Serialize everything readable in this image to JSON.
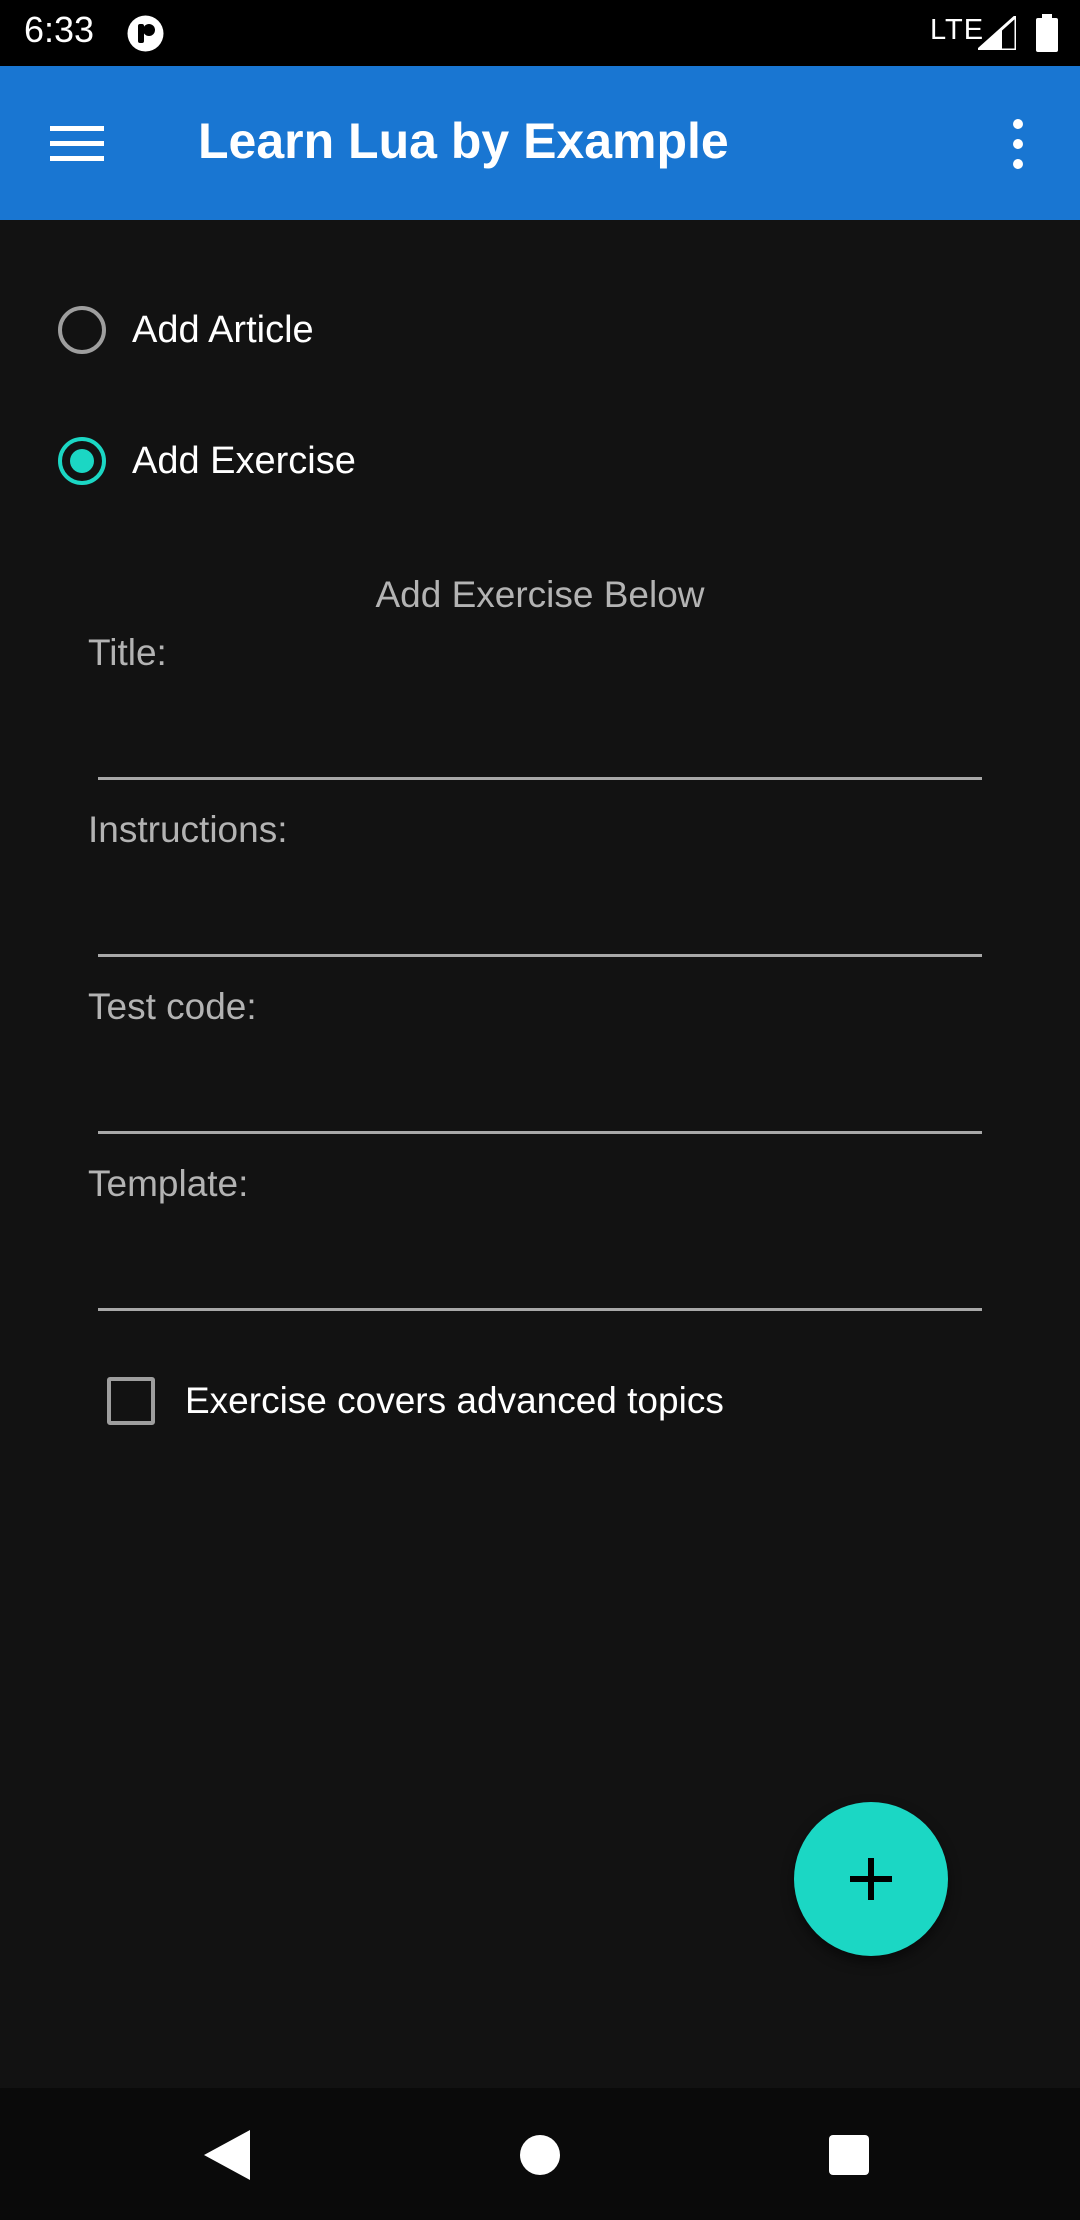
{
  "status_bar": {
    "time": "6:33",
    "network": "LTE",
    "icons": [
      "app-notification-icon",
      "signal-icon",
      "battery-icon"
    ]
  },
  "app_bar": {
    "title": "Learn Lua by Example",
    "icons": [
      "menu-icon",
      "more-vert-icon"
    ],
    "color": "#1976d2"
  },
  "mode": {
    "options": [
      {
        "label": "Add Article",
        "selected": false
      },
      {
        "label": "Add Exercise",
        "selected": true
      }
    ],
    "accent_color": "#1bd7c4"
  },
  "form": {
    "heading": "Add Exercise Below",
    "fields": [
      {
        "label": "Title:",
        "value": ""
      },
      {
        "label": "Instructions:",
        "value": ""
      },
      {
        "label": "Test code:",
        "value": ""
      },
      {
        "label": "Template:",
        "value": ""
      }
    ],
    "advanced_checkbox": {
      "label": "Exercise covers advanced topics",
      "checked": false
    }
  },
  "fab": {
    "icon": "plus-icon",
    "color": "#1bd7c4"
  },
  "nav_bar": {
    "icons": [
      "back-icon",
      "home-icon",
      "recents-icon"
    ]
  }
}
